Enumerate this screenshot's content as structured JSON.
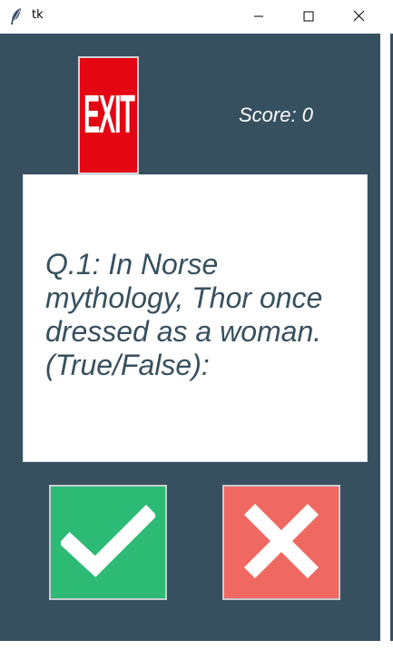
{
  "window": {
    "title": "tk",
    "controls": [
      "minimize-icon",
      "maximize-icon",
      "close-icon"
    ]
  },
  "header": {
    "exit_label": "EXIT",
    "score_text": "Score: 0"
  },
  "question": {
    "text": "Q.1: In Norse mythology, Thor once dressed as a woman. (True/False):"
  },
  "answers": {
    "true_icon": "check-icon",
    "false_icon": "cross-icon"
  },
  "colors": {
    "background": "#37505f",
    "exit": "#e30613",
    "true": "#2dba74",
    "false": "#ef6862",
    "card": "#ffffff"
  }
}
